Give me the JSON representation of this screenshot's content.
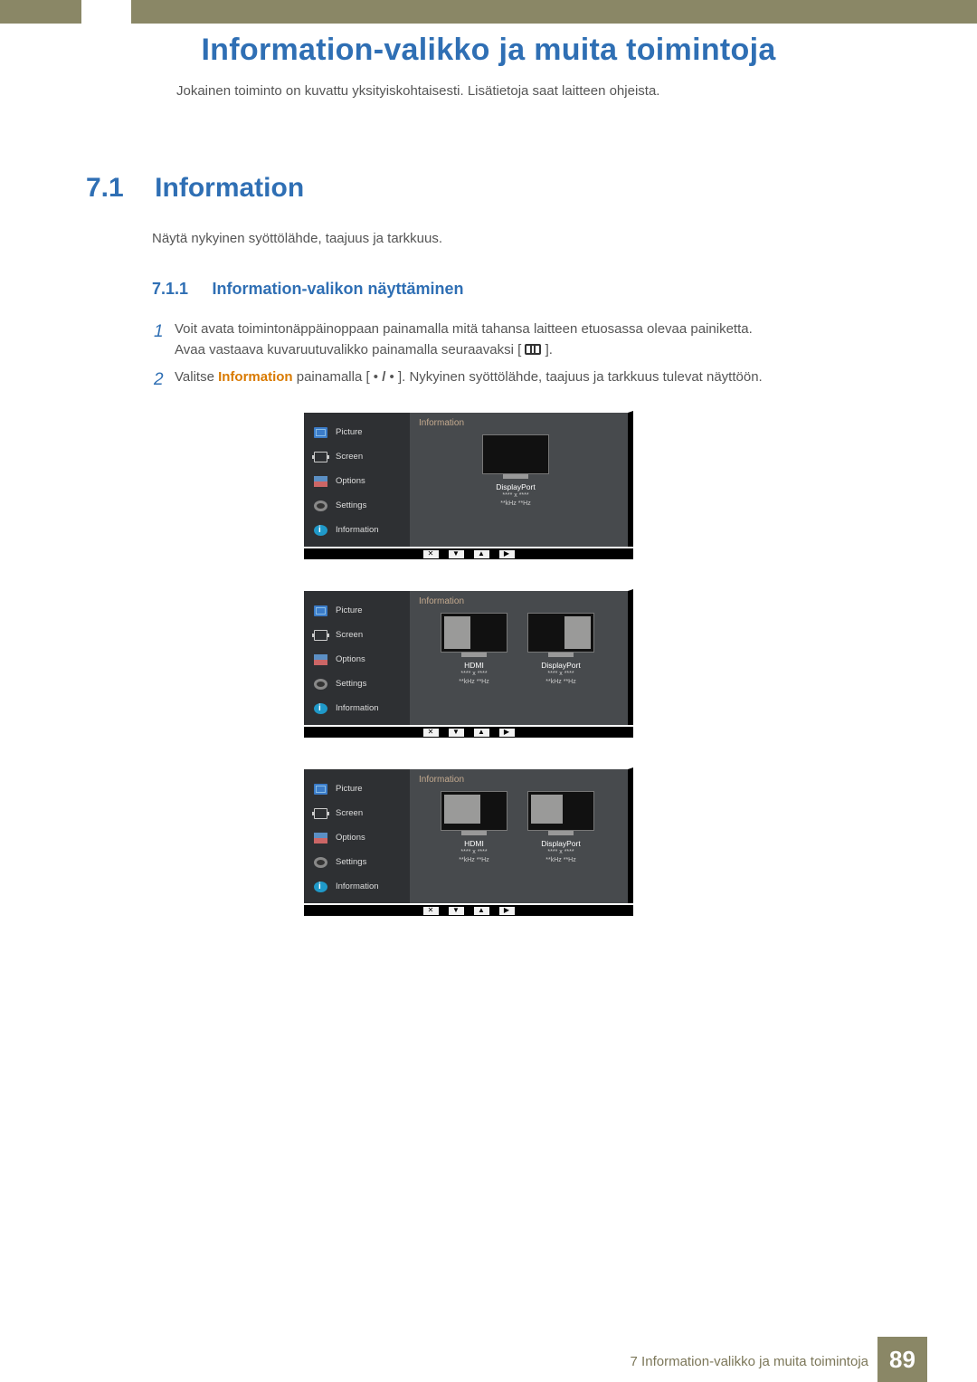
{
  "chapter_title": "Information-valikko ja muita toimintoja",
  "intro": "Jokainen toiminto on kuvattu yksityiskohtaisesti. Lisätietoja saat laitteen ohjeista.",
  "section": {
    "num": "7.1",
    "title": "Information",
    "desc": "Näytä nykyinen syöttölähde, taajuus ja tarkkuus."
  },
  "subsection": {
    "num": "7.1.1",
    "title": "Information-valikon näyttäminen"
  },
  "step1": {
    "num": "1",
    "line1": "Voit avata toimintonäppäinoppaan painamalla mitä tahansa laitteen etuosassa olevaa painiketta.",
    "line2a": "Avaa vastaava kuvaruutuvalikko painamalla seuraavaksi [ ",
    "line2b": " ]."
  },
  "step2": {
    "num": "2",
    "a": "Valitse ",
    "hl": "Information",
    "b": " painamalla [ • ",
    "c": "/",
    "d": " • ]. Nykyinen syöttölähde, taajuus ja tarkkuus tulevat näyttöön."
  },
  "osd_sidebar": {
    "picture": "Picture",
    "screen": "Screen",
    "options": "Options",
    "settings": "Settings",
    "information": "Information"
  },
  "osd_title": "Information",
  "signals": {
    "displayport": "DisplayPort",
    "hdmi": "HDMI",
    "res": "**** x ****",
    "freq": "**kHz **Hz"
  },
  "nav": {
    "close": "✕",
    "down": "▼",
    "up": "▲",
    "right": "▶"
  },
  "footer": {
    "text": "7 Information-valikko ja muita toimintoja",
    "page": "89"
  }
}
